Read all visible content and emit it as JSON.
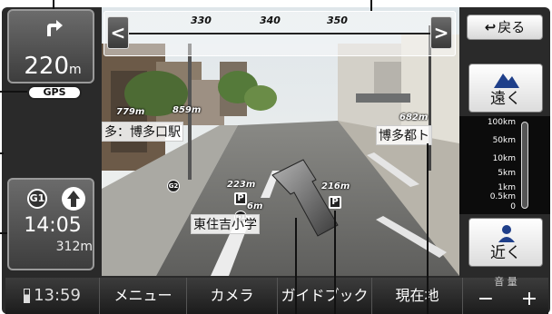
{
  "compass": {
    "headings": [
      "330",
      "340",
      "350"
    ],
    "left_arrow": "<",
    "right_arrow": ">"
  },
  "turn_panel": {
    "distance": "220",
    "unit": "m"
  },
  "gps_badge": "GPS",
  "time_panel": {
    "route_badge": "G1",
    "eta_time": "14:05",
    "eta_distance": "312m"
  },
  "right_panel": {
    "back_label": "戻る",
    "back_icon": "↩",
    "far_label": "遠く",
    "near_label": "近く",
    "scale_labels": [
      "100km",
      "50km",
      "10km",
      "5km",
      "1km",
      "0.5km",
      "0"
    ]
  },
  "overlays": {
    "poi_station": "多：博多口駅",
    "poi_station_dist": "779m",
    "poi_station_dist2": "859m",
    "poi_toho": "博多都ト",
    "poi_toho_dist": "682m",
    "poi_school": "東住吉小学",
    "dist_223": "223m",
    "dist_216": "216m",
    "dist_6": "6m",
    "g2_badge": "G2",
    "g1_badge": "G1",
    "p_badge": "P"
  },
  "menubar": {
    "clock": "13:59",
    "menu": "メニュー",
    "camera": "カメラ",
    "guidebook": "ガイドブック",
    "current_location": "現在地",
    "volume_label": "音 量",
    "volume_minus": "−",
    "volume_plus": "+"
  },
  "colors": {
    "panel_gradient_top": "#6b6b6b",
    "panel_gradient_bottom": "#3d3d3d",
    "menubar": "#2a2a2a",
    "arrow_fill": "#555555"
  }
}
